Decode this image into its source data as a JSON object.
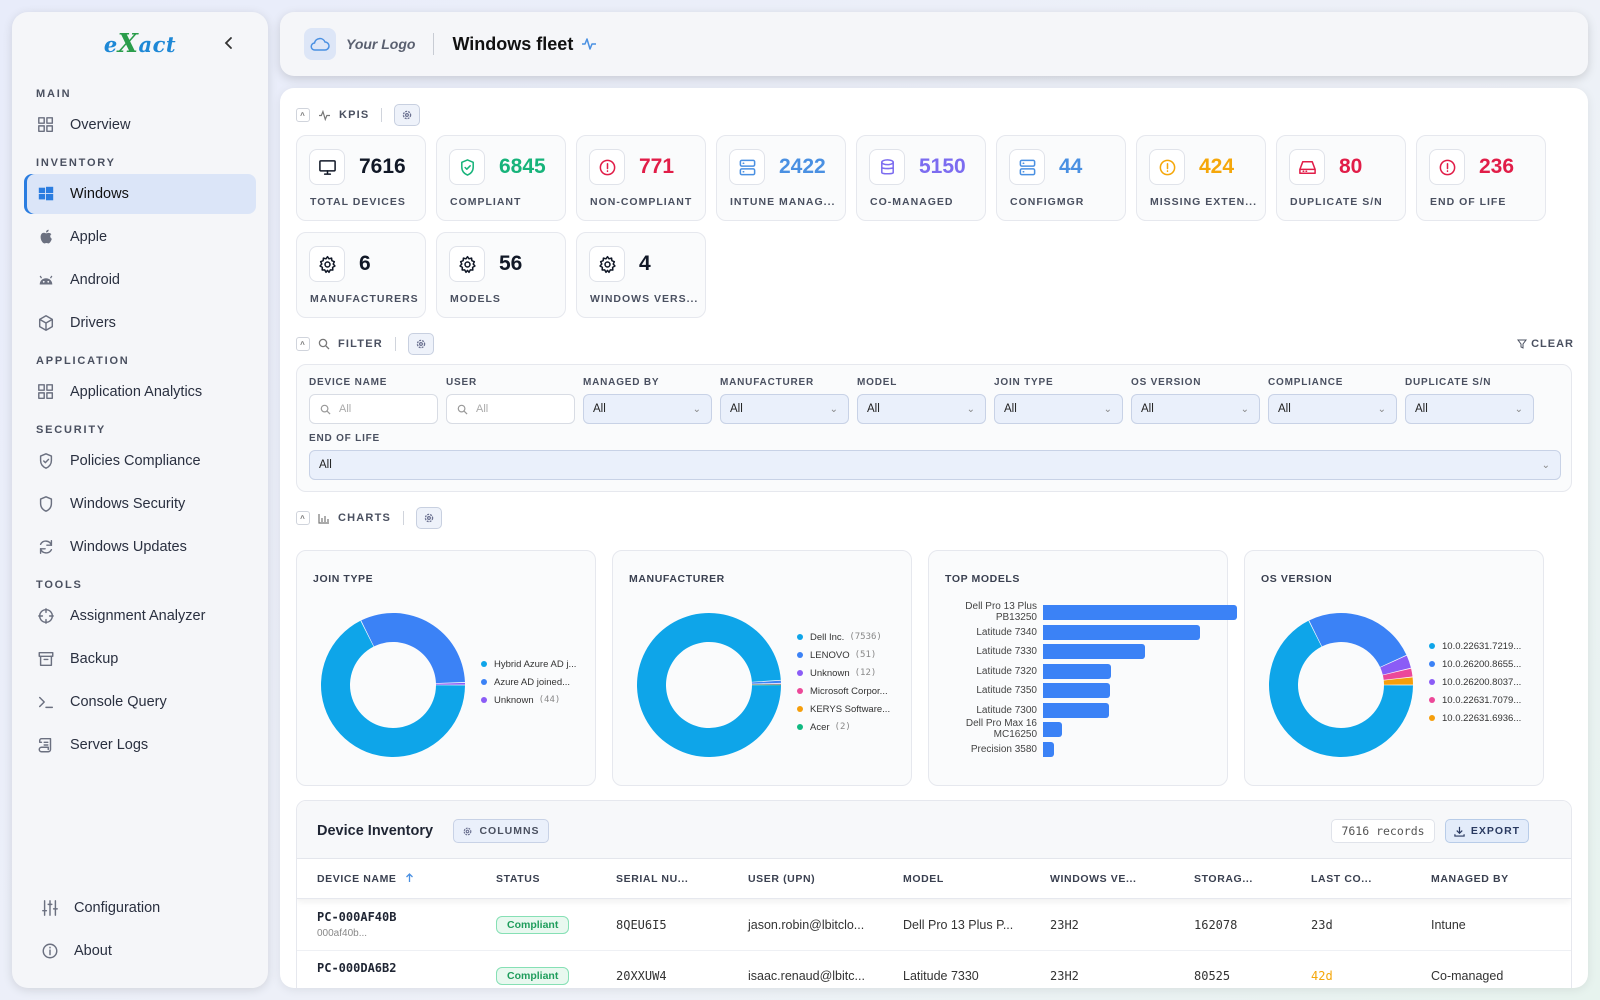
{
  "sidebar": {
    "logo": {
      "pre": "e",
      "mark": "X",
      "post": "act"
    },
    "sections": [
      {
        "title": "MAIN",
        "items": [
          {
            "label": "Overview",
            "icon": "grid-icon"
          }
        ]
      },
      {
        "title": "INVENTORY",
        "items": [
          {
            "label": "Windows",
            "icon": "windows-icon",
            "active": true
          },
          {
            "label": "Apple",
            "icon": "apple-icon"
          },
          {
            "label": "Android",
            "icon": "android-icon"
          },
          {
            "label": "Drivers",
            "icon": "package-icon"
          }
        ]
      },
      {
        "title": "APPLICATION",
        "items": [
          {
            "label": "Application Analytics",
            "icon": "grid-icon"
          }
        ]
      },
      {
        "title": "SECURITY",
        "items": [
          {
            "label": "Policies Compliance",
            "icon": "shield-check-icon"
          },
          {
            "label": "Windows Security",
            "icon": "shield-icon"
          },
          {
            "label": "Windows Updates",
            "icon": "refresh-icon"
          }
        ]
      },
      {
        "title": "TOOLS",
        "items": [
          {
            "label": "Assignment Analyzer",
            "icon": "crosshair-icon"
          },
          {
            "label": "Backup",
            "icon": "archive-icon"
          },
          {
            "label": "Console Query",
            "icon": "terminal-icon"
          },
          {
            "label": "Server Logs",
            "icon": "scroll-icon"
          }
        ]
      }
    ],
    "bottom": [
      {
        "label": "Configuration",
        "icon": "sliders-icon"
      },
      {
        "label": "About",
        "icon": "info-icon"
      }
    ]
  },
  "header": {
    "logo_text": "Your Logo",
    "title": "Windows fleet"
  },
  "kpis": {
    "section_label": "KPIS",
    "items": [
      {
        "value": "7616",
        "label": "TOTAL DEVICES",
        "color": "#111827",
        "icon": "monitor-icon"
      },
      {
        "value": "6845",
        "label": "COMPLIANT",
        "color": "#16b37a",
        "icon": "shield-check-icon"
      },
      {
        "value": "771",
        "label": "NON-COMPLIANT",
        "color": "#e11d48",
        "icon": "alert-circle-icon"
      },
      {
        "value": "2422",
        "label": "INTUNE MANAG...",
        "color": "#4a90e2",
        "icon": "server-icon"
      },
      {
        "value": "5150",
        "label": "CO-MANAGED",
        "color": "#7c6cf0",
        "icon": "database-icon"
      },
      {
        "value": "44",
        "label": "CONFIGMGR",
        "color": "#4a90e2",
        "icon": "server-icon"
      },
      {
        "value": "424",
        "label": "MISSING EXTEN...",
        "color": "#f5a70a",
        "icon": "alert-circle-icon"
      },
      {
        "value": "80",
        "label": "DUPLICATE S/N",
        "color": "#e11d48",
        "icon": "hard-drive-icon"
      },
      {
        "value": "236",
        "label": "END OF LIFE",
        "color": "#e11d48",
        "icon": "alert-circle-icon"
      },
      {
        "value": "6",
        "label": "MANUFACTURERS",
        "color": "#111827",
        "icon": "gear-icon"
      },
      {
        "value": "56",
        "label": "MODELS",
        "color": "#111827",
        "icon": "gear-icon"
      },
      {
        "value": "4",
        "label": "WINDOWS VERS...",
        "color": "#111827",
        "icon": "gear-icon"
      }
    ]
  },
  "filter": {
    "section_label": "FILTER",
    "clear_label": "CLEAR",
    "device_name": {
      "label": "DEVICE NAME",
      "placeholder": "All"
    },
    "user": {
      "label": "USER",
      "placeholder": "All"
    },
    "selects": [
      {
        "label": "MANAGED BY",
        "value": "All"
      },
      {
        "label": "MANUFACTURER",
        "value": "All"
      },
      {
        "label": "MODEL",
        "value": "All"
      },
      {
        "label": "JOIN TYPE",
        "value": "All"
      },
      {
        "label": "OS VERSION",
        "value": "All"
      },
      {
        "label": "COMPLIANCE",
        "value": "All"
      },
      {
        "label": "DUPLICATE S/N",
        "value": "All"
      }
    ],
    "end_of_life": {
      "label": "END OF LIFE",
      "value": "All"
    }
  },
  "charts": {
    "section_label": "CHARTS"
  },
  "chart_data": [
    {
      "type": "pie",
      "title": "JOIN TYPE",
      "donut": true,
      "labels": [
        "Hybrid Azure AD j...",
        "Azure AD joined...",
        "Unknown"
      ],
      "counts": [
        "",
        "",
        "(44)"
      ],
      "values": [
        5150,
        2422,
        44
      ],
      "colors": [
        "#0ea5e9",
        "#3b82f6",
        "#8b5cf6"
      ],
      "legend_position": "right"
    },
    {
      "type": "pie",
      "title": "MANUFACTURER",
      "donut": true,
      "labels": [
        "Dell Inc.",
        "LENOVO",
        "Unknown",
        "Microsoft Corpor...",
        "KERYS Software...",
        "Acer"
      ],
      "counts": [
        "(7536)",
        "(51)",
        "(12)",
        "",
        "",
        "(2)"
      ],
      "values": [
        7536,
        51,
        12,
        8,
        7,
        2
      ],
      "colors": [
        "#0ea5e9",
        "#3b82f6",
        "#8b5cf6",
        "#ec4899",
        "#f59e0b",
        "#10b981"
      ],
      "legend_position": "right"
    },
    {
      "type": "bar",
      "orientation": "horizontal",
      "title": "TOP MODELS",
      "categories": [
        "Dell Pro 13 Plus PB13250",
        "Latitude 7340",
        "Latitude 7330",
        "Latitude 7320",
        "Latitude 7350",
        "Latitude 7300",
        "Dell Pro Max 16 MC16250",
        "Precision 3580"
      ],
      "values": [
        1980,
        1600,
        1040,
        690,
        680,
        670,
        190,
        110
      ],
      "color": "#3b82f6"
    },
    {
      "type": "pie",
      "title": "OS VERSION",
      "donut": true,
      "labels": [
        "10.0.22631.7219...",
        "10.0.26200.8655...",
        "10.0.26200.8037...",
        "10.0.22631.7079...",
        "10.0.22631.6936..."
      ],
      "counts": [
        "",
        "",
        "",
        "",
        ""
      ],
      "values": [
        5150,
        1950,
        230,
        150,
        136
      ],
      "colors": [
        "#0ea5e9",
        "#3b82f6",
        "#8b5cf6",
        "#ec4899",
        "#f59e0b"
      ],
      "legend_position": "right"
    }
  ],
  "table": {
    "title": "Device Inventory",
    "columns_label": "COLUMNS",
    "records": "7616 records",
    "export_label": "EXPORT",
    "headers": [
      "DEVICE NAME",
      "STATUS",
      "SERIAL NU...",
      "USER (UPN)",
      "MODEL",
      "WINDOWS VE...",
      "STORAG...",
      "LAST CO...",
      "MANAGED BY"
    ],
    "rows": [
      {
        "name": "PC-000AF40B",
        "sub": "000af40b...",
        "status": "Compliant",
        "serial": "8QEU6I5",
        "user": "jason.robin@lbitclo...",
        "model": "Dell Pro 13 Plus P...",
        "winver": "23H2",
        "storage": "162078",
        "last": "23d",
        "last_color": "#333333",
        "managed": "Intune"
      },
      {
        "name": "PC-000DA6B2",
        "sub": "",
        "status": "Compliant",
        "serial": "20XXUW4",
        "user": "isaac.renaud@lbitc...",
        "model": "Latitude 7330",
        "winver": "23H2",
        "storage": "80525",
        "last": "42d",
        "last_color": "#f5a70a",
        "managed": "Co-managed"
      }
    ]
  }
}
